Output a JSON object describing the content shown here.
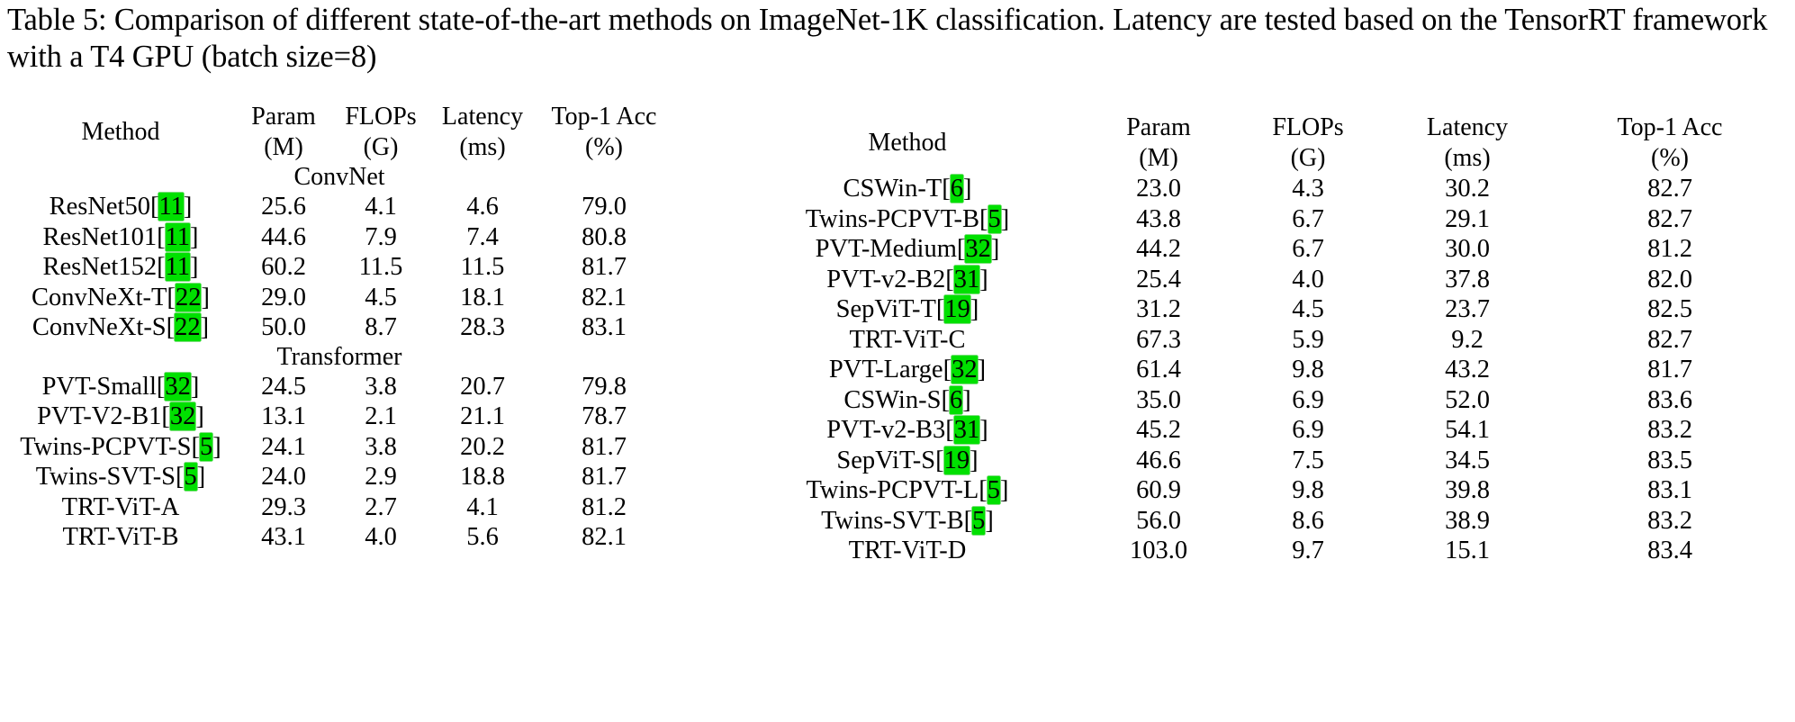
{
  "caption": {
    "text": "Table 5: Comparison of different state-of-the-art methods on ImageNet-1K classification. Latency are tested based on the TensorRT framework with a T4 GPU (batch size=8)"
  },
  "highlight_color": "#00e000",
  "columns": {
    "method": {
      "line1": "Method",
      "line2": ""
    },
    "param": {
      "line1": "Param",
      "line2": "(M)"
    },
    "flops": {
      "line1": "FLOPs",
      "line2": "(G)"
    },
    "latency": {
      "line1": "Latency",
      "line2": "(ms)"
    },
    "acc": {
      "line1": "Top-1 Acc",
      "line2": "(%)"
    }
  },
  "tables": [
    {
      "id": "left",
      "groups": [
        {
          "label": "ConvNet",
          "rows": [
            {
              "method": "ResNet50[",
              "cite": "11",
              "method_end": "]",
              "param": "25.6",
              "flops": "4.1",
              "latency": "4.6",
              "acc": "79.0",
              "bold_method": false,
              "bold_latency": false,
              "bold_acc": false
            },
            {
              "method": "ResNet101[",
              "cite": "11",
              "method_end": "]",
              "param": "44.6",
              "flops": "7.9",
              "latency": "7.4",
              "acc": "80.8",
              "bold_method": false,
              "bold_latency": false,
              "bold_acc": false
            },
            {
              "method": "ResNet152[",
              "cite": "11",
              "method_end": "]",
              "param": "60.2",
              "flops": "11.5",
              "latency": "11.5",
              "acc": "81.7",
              "bold_method": false,
              "bold_latency": false,
              "bold_acc": false
            },
            {
              "method": "ConvNeXt-T[",
              "cite": "22",
              "method_end": "]",
              "param": "29.0",
              "flops": "4.5",
              "latency": "18.1",
              "acc": "82.1",
              "bold_method": false,
              "bold_latency": false,
              "bold_acc": false
            },
            {
              "method": "ConvNeXt-S[",
              "cite": "22",
              "method_end": "]",
              "param": "50.0",
              "flops": "8.7",
              "latency": "28.3",
              "acc": "83.1",
              "bold_method": false,
              "bold_latency": false,
              "bold_acc": false
            }
          ]
        },
        {
          "label": "Transformer",
          "rows": [
            {
              "method": "PVT-Small[",
              "cite": "32",
              "method_end": "]",
              "param": "24.5",
              "flops": "3.8",
              "latency": "20.7",
              "acc": "79.8",
              "bold_method": false,
              "bold_latency": false,
              "bold_acc": false
            },
            {
              "method": "PVT-V2-B1[",
              "cite": "32",
              "method_end": "]",
              "param": "13.1",
              "flops": "2.1",
              "latency": "21.1",
              "acc": "78.7",
              "bold_method": false,
              "bold_latency": false,
              "bold_acc": false
            },
            {
              "method": "Twins-PCPVT-S[",
              "cite": "5",
              "method_end": "]",
              "param": "24.1",
              "flops": "3.8",
              "latency": "20.2",
              "acc": "81.7",
              "bold_method": false,
              "bold_latency": false,
              "bold_acc": false
            },
            {
              "method": "Twins-SVT-S[",
              "cite": "5",
              "method_end": "]",
              "param": "24.0",
              "flops": "2.9",
              "latency": "18.8",
              "acc": "81.7",
              "bold_method": false,
              "bold_latency": false,
              "bold_acc": false
            },
            {
              "method": "TRT-ViT-A",
              "cite": "",
              "method_end": "",
              "param": "29.3",
              "flops": "2.7",
              "latency": "4.1",
              "acc": "81.2",
              "bold_method": true,
              "bold_latency": true,
              "bold_acc": true
            },
            {
              "method": "TRT-ViT-B",
              "cite": "",
              "method_end": "",
              "param": "43.1",
              "flops": "4.0",
              "latency": "5.6",
              "acc": "82.1",
              "bold_method": true,
              "bold_latency": true,
              "bold_acc": true
            }
          ]
        }
      ]
    },
    {
      "id": "right",
      "groups": [
        {
          "label": "",
          "rows": [
            {
              "method": "CSWin-T[",
              "cite": "6",
              "method_end": "]",
              "param": "23.0",
              "flops": "4.3",
              "latency": "30.2",
              "acc": "82.7",
              "bold_method": false,
              "bold_latency": false,
              "bold_acc": false
            },
            {
              "method": "Twins-PCPVT-B[",
              "cite": "5",
              "method_end": "]",
              "param": "43.8",
              "flops": "6.7",
              "latency": "29.1",
              "acc": "82.7",
              "bold_method": false,
              "bold_latency": false,
              "bold_acc": false
            },
            {
              "method": "PVT-Medium[",
              "cite": "32",
              "method_end": "]",
              "param": "44.2",
              "flops": "6.7",
              "latency": "30.0",
              "acc": "81.2",
              "bold_method": false,
              "bold_latency": false,
              "bold_acc": false
            },
            {
              "method": "PVT-v2-B2[",
              "cite": "31",
              "method_end": "]",
              "param": "25.4",
              "flops": "4.0",
              "latency": "37.8",
              "acc": "82.0",
              "bold_method": false,
              "bold_latency": false,
              "bold_acc": false
            },
            {
              "method": "SepViT-T[",
              "cite": "19",
              "method_end": "]",
              "param": "31.2",
              "flops": "4.5",
              "latency": "23.7",
              "acc": "82.5",
              "bold_method": false,
              "bold_latency": false,
              "bold_acc": false
            },
            {
              "method": "TRT-ViT-C",
              "cite": "",
              "method_end": "",
              "param": "67.3",
              "flops": "5.9",
              "latency": "9.2",
              "acc": "82.7",
              "bold_method": true,
              "bold_latency": true,
              "bold_acc": true
            }
          ]
        },
        {
          "label": "",
          "rows": [
            {
              "method": "PVT-Large[",
              "cite": "32",
              "method_end": "]",
              "param": "61.4",
              "flops": "9.8",
              "latency": "43.2",
              "acc": "81.7",
              "bold_method": false,
              "bold_latency": false,
              "bold_acc": false
            },
            {
              "method": "CSWin-S[",
              "cite": "6",
              "method_end": "]",
              "param": "35.0",
              "flops": "6.9",
              "latency": "52.0",
              "acc": "83.6",
              "bold_method": false,
              "bold_latency": false,
              "bold_acc": false
            },
            {
              "method": "PVT-v2-B3[",
              "cite": "31",
              "method_end": "]",
              "param": "45.2",
              "flops": "6.9",
              "latency": "54.1",
              "acc": "83.2",
              "bold_method": false,
              "bold_latency": false,
              "bold_acc": false
            },
            {
              "method": "SepViT-S[",
              "cite": "19",
              "method_end": "]",
              "param": "46.6",
              "flops": "7.5",
              "latency": "34.5",
              "acc": "83.5",
              "bold_method": false,
              "bold_latency": false,
              "bold_acc": false
            },
            {
              "method": "Twins-PCPVT-L[",
              "cite": "5",
              "method_end": "]",
              "param": "60.9",
              "flops": "9.8",
              "latency": "39.8",
              "acc": "83.1",
              "bold_method": false,
              "bold_latency": false,
              "bold_acc": false
            },
            {
              "method": "Twins-SVT-B[",
              "cite": "5",
              "method_end": "]",
              "param": "56.0",
              "flops": "8.6",
              "latency": "38.9",
              "acc": "83.2",
              "bold_method": false,
              "bold_latency": false,
              "bold_acc": false
            },
            {
              "method": "TRT-ViT-D",
              "cite": "",
              "method_end": "",
              "param": "103.0",
              "flops": "9.7",
              "latency": "15.1",
              "acc": "83.4",
              "bold_method": true,
              "bold_latency": true,
              "bold_acc": true
            }
          ]
        }
      ]
    }
  ]
}
